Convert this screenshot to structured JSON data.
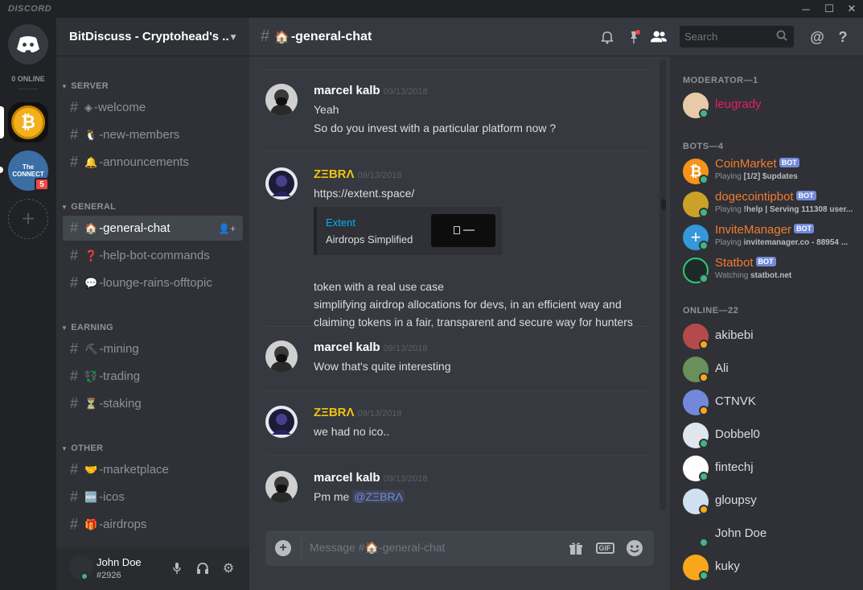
{
  "app": {
    "logo": "DISCORD"
  },
  "servers": {
    "online_label": "0 ONLINE",
    "connect_badge": "5",
    "connect_label": "The CONNECT",
    "add_symbol": "+"
  },
  "guild": {
    "name": "BitDiscuss - Cryptohead's ..."
  },
  "categories": {
    "server": "SERVER",
    "general": "GENERAL",
    "earning": "EARNING",
    "other": "OTHER"
  },
  "channels": [
    {
      "emoji": "◈",
      "label": "-welcome"
    },
    {
      "emoji": "🐧",
      "label": "-new-members"
    },
    {
      "emoji": "🔔",
      "label": "-announcements"
    },
    {
      "emoji": "🏠",
      "label": "-general-chat"
    },
    {
      "emoji": "❓",
      "label": "-help-bot-commands"
    },
    {
      "emoji": "💬",
      "label": "-lounge-rains-offtopic"
    },
    {
      "emoji": "⛏",
      "label": "-mining"
    },
    {
      "emoji": "💱",
      "label": "-trading"
    },
    {
      "emoji": "⏳",
      "label": "-staking"
    },
    {
      "emoji": "🤝",
      "label": "-marketplace"
    },
    {
      "emoji": "🆕",
      "label": "-icos"
    },
    {
      "emoji": "🎁",
      "label": "-airdrops"
    }
  ],
  "user": {
    "name": "John Doe",
    "discriminator": "#2926"
  },
  "chat": {
    "title_emoji": "🏠",
    "title": "-general-chat",
    "search_placeholder": "Search",
    "composer_placeholder": "Message #🏠-general-chat",
    "gif_label": "GIF"
  },
  "messages": [
    {
      "author": "marcel kalb",
      "timestamp": "09/13/2018",
      "lines": [
        "Yeah",
        "So do you invest with a particular platform now ?"
      ]
    },
    {
      "author": "ZΞBRΛ",
      "timestamp": "09/13/2018",
      "link": "https://extent.space/",
      "embed": {
        "provider": "Extent",
        "description": "Airdrops Simplified"
      },
      "lines": [
        "token with a real use case",
        "simplifying airdrop allocations for devs, in an efficient way and",
        "claiming tokens in a fair, transparent and secure way for hunters"
      ]
    },
    {
      "author": "marcel kalb",
      "timestamp": "09/13/2018",
      "lines": [
        "Wow that's quite interesting"
      ]
    },
    {
      "author": "ZΞBRΛ",
      "timestamp": "09/13/2018",
      "lines": [
        "we had no ico.."
      ]
    },
    {
      "author": "marcel kalb",
      "timestamp": "09/13/2018",
      "lines": [
        "Pm me"
      ],
      "mention": "@ZΞBRΛ"
    }
  ],
  "members": {
    "moderator_header": "MODERATOR—1",
    "bots_header": "BOTS—4",
    "online_header": "ONLINE—22",
    "bot_tag": "BOT",
    "moderators": [
      {
        "name": "leugrady",
        "color": "#e91e63"
      }
    ],
    "bots": [
      {
        "name": "CoinMarket",
        "activity_prefix": "Playing",
        "activity": "[1/2] $updates"
      },
      {
        "name": "dogecointipbot",
        "activity_prefix": "Playing",
        "activity": "!help | Serving 111308 user..."
      },
      {
        "name": "InviteManager",
        "activity_prefix": "Playing",
        "activity": "invitemanager.co - 88954 ..."
      },
      {
        "name": "Statbot",
        "activity_prefix": "Watching",
        "activity": "statbot.net"
      }
    ],
    "online": [
      "akibebi",
      "Ali",
      "CTNVK",
      "Dobbel0",
      "fintechj",
      "gloupsy",
      "John Doe",
      "kuky"
    ]
  },
  "colors": {
    "accent": "#7289da",
    "online": "#43b581",
    "idle": "#faa61a",
    "link": "#00b0f4",
    "zebra": "#f1c40f",
    "bot_name": "#f47b2e"
  }
}
